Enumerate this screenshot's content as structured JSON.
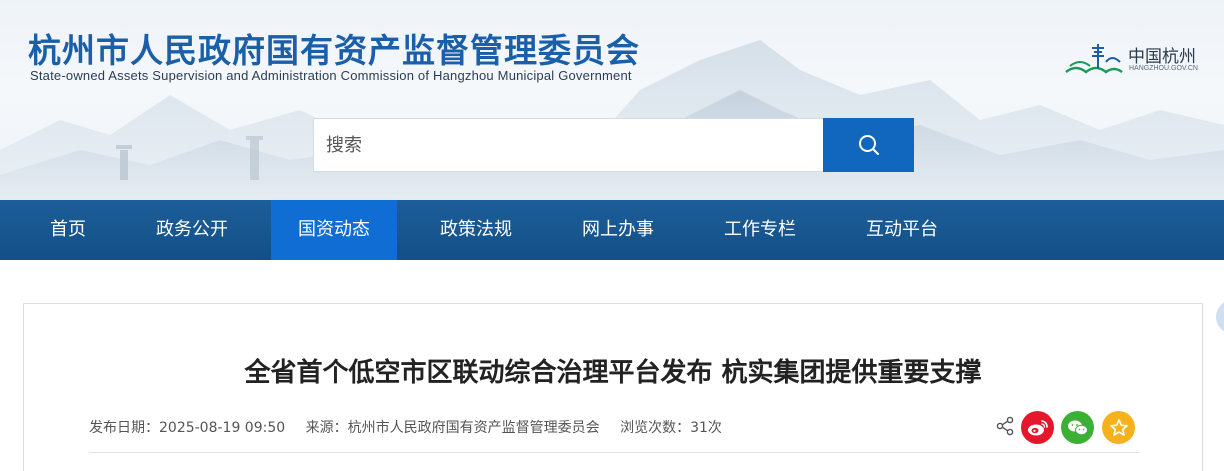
{
  "header": {
    "title": "杭州市人民政府国有资产监督管理委员会",
    "subtitle": "State-owned  Assets Supervision and Administration Commission of Hangzhou Municipal  Government",
    "brand_name": "中国杭州",
    "brand_domain": "HANGZHOU.GOV.CN"
  },
  "search": {
    "placeholder": "搜索"
  },
  "nav": {
    "items": [
      "首页",
      "政务公开",
      "国资动态",
      "政策法规",
      "网上办事",
      "工作专栏",
      "互动平台"
    ],
    "active_index": 2
  },
  "article": {
    "title": "全省首个低空市区联动综合治理平台发布 杭实集团提供重要支撑",
    "publish_date": "发布日期：2025-08-19 09:50",
    "source": "来源：杭州市人民政府国有资产监督管理委员会",
    "views": "浏览次数：31次"
  },
  "icons": {
    "search": "search-icon",
    "share": "share-icon",
    "weibo": "weibo-icon",
    "wechat": "wechat-icon",
    "favorite": "star-icon"
  },
  "colors": {
    "brand_blue": "#1167bd",
    "nav_bg": "#1a5893",
    "nav_active": "#0f6dd3",
    "weibo": "#e6162d",
    "wechat": "#3cb034",
    "favorite": "#f5b21d"
  }
}
